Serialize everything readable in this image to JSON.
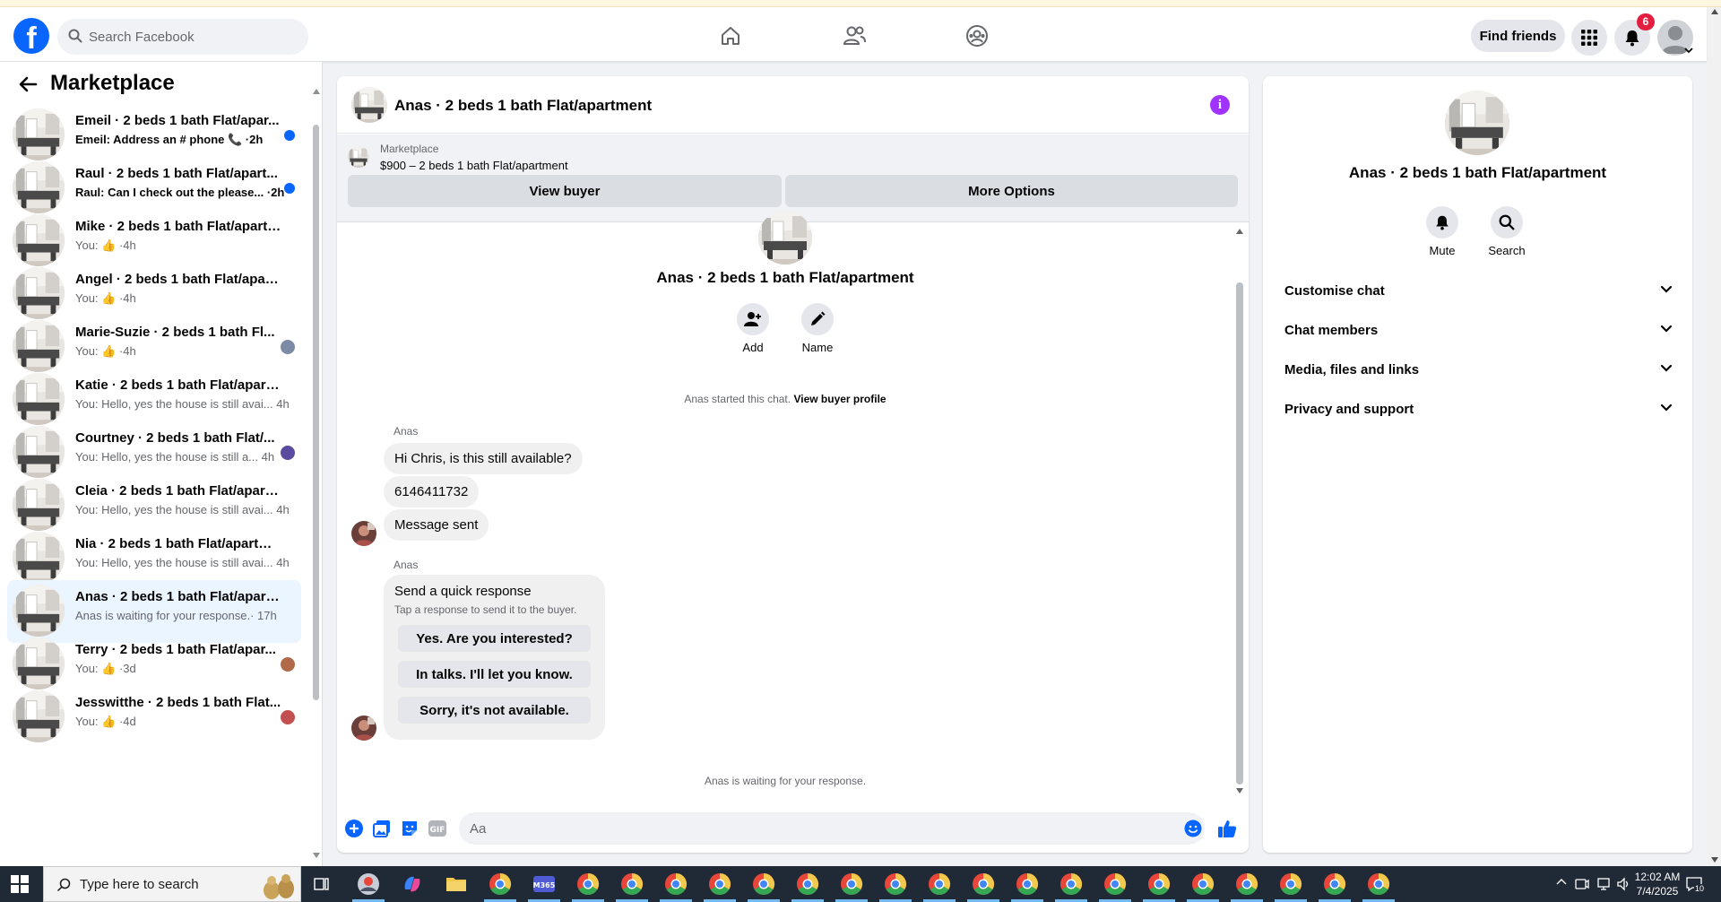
{
  "header": {
    "search_placeholder": "Search Facebook",
    "find_friends": "Find friends",
    "notif_count": "6",
    "logo_letter": "f"
  },
  "sidebar": {
    "title": "Marketplace",
    "conversations": [
      {
        "name": "Emeil · 2 beds 1 bath Flat/apar...",
        "snippet": "Emeil: Address an # phone 📞 ·2h",
        "unread": true
      },
      {
        "name": "Raul · 2 beds 1 bath Flat/apart...",
        "snippet": "Raul: Can I check out the please... ·2h",
        "unread": true
      },
      {
        "name": "Mike · 2 beds 1 bath Flat/apartm...",
        "snippet": "You: 👍 ·4h"
      },
      {
        "name": "Angel · 2 beds 1 bath Flat/apart...",
        "snippet": "You: 👍 ·4h"
      },
      {
        "name": "Marie-Suzie · 2 beds 1 bath Fl...",
        "snippet": "You: 👍 ·4h"
      },
      {
        "name": "Katie · 2 beds 1 bath Flat/apartm...",
        "snippet": "You: Hello, yes the house is still avai... 4h"
      },
      {
        "name": "Courtney · 2 beds 1 bath Flat/...",
        "snippet": "You: Hello, yes the house is still a... 4h"
      },
      {
        "name": "Cleia · 2 beds 1 bath Flat/apartm...",
        "snippet": "You: Hello, yes the house is still avai... 4h"
      },
      {
        "name": "Nia · 2 beds 1 bath Flat/apartment",
        "snippet": "You: Hello, yes the house is still avai... 4h"
      },
      {
        "name": "Anas · 2 beds 1 bath Flat/apartm...",
        "snippet": "Anas is waiting for your response.· 17h",
        "active": true
      },
      {
        "name": "Terry · 2 beds 1 bath Flat/apar...",
        "snippet": "You: 👍 ·3d"
      },
      {
        "name": "Jesswitthe · 2 beds 1 bath Flat...",
        "snippet": "You: 👍 ·4d"
      }
    ]
  },
  "chat": {
    "title": "Anas · 2 beds 1 bath Flat/apartment",
    "listing_source": "Marketplace",
    "listing_title": "$900 – 2 beds 1 bath Flat/apartment",
    "view_buyer": "View buyer",
    "more_options": "More Options",
    "center_title": "Anas · 2 beds 1 bath Flat/apartment",
    "add_label": "Add",
    "name_label": "Name",
    "started_text": "Anas started this chat.",
    "view_buyer_profile": "View buyer profile",
    "sender1": "Anas",
    "msg1": "Hi Chris, is this still available?",
    "msg2": "6146411732",
    "msg3": "Message sent",
    "sender2": "Anas",
    "quick_title": "Send a quick response",
    "quick_sub": "Tap a response to send it to the buyer.",
    "quick_options": [
      "Yes. Are you interested?",
      "In talks. I'll let you know.",
      "Sorry, it's not available."
    ],
    "waiting": "Anas is waiting for your response.",
    "input_placeholder": "Aa"
  },
  "right_panel": {
    "title": "Anas · 2 beds 1 bath Flat/apartment",
    "mute": "Mute",
    "search": "Search",
    "sections": [
      "Customise chat",
      "Chat members",
      "Media, files and links",
      "Privacy and support"
    ]
  },
  "taskbar": {
    "search_text": "Type here to search",
    "time": "12:02 AM",
    "date": "7/4/2025",
    "notif_count": "10"
  },
  "colors": {
    "brand": "#0866ff",
    "accent_purple": "#a033ff",
    "badge_red": "#e41e3f",
    "active_conv_bg": "#ebf5ff"
  }
}
